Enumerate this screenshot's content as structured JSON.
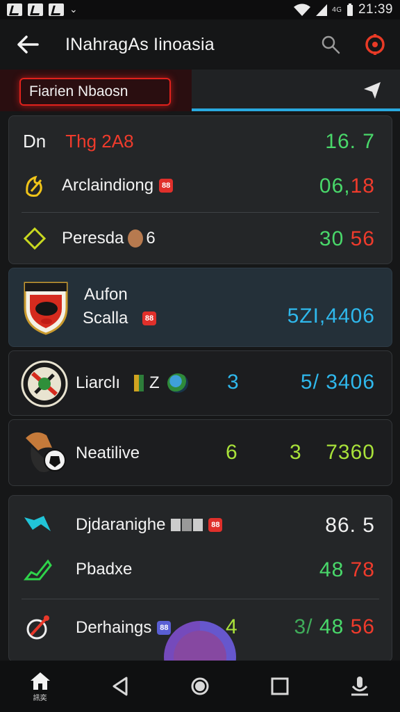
{
  "status_bar": {
    "time": "21:39",
    "signal_label": "4G"
  },
  "app_bar": {
    "title": "INahragAs Iinoasia"
  },
  "tabs": {
    "active_label": "Fiarien Nbaosn"
  },
  "card1": {
    "header": {
      "left": "Dn",
      "right_title": "Thg 2A8",
      "value": "16. 7"
    },
    "rows": [
      {
        "label": "Arclaindiong",
        "badge": "88",
        "value_a": "06",
        "value_sep": ",",
        "value_b": "18"
      },
      {
        "label": "Peresda",
        "suffix": "6",
        "value_a": "30",
        "value_b": "56"
      }
    ]
  },
  "card2": {
    "line1": "Aufon",
    "line2": "Scalla",
    "badge": "88",
    "value": "5ZI,4406"
  },
  "card3": {
    "label": "Liarclı",
    "mark_a": "Z",
    "col_mid": "3",
    "value": "5/ 3406"
  },
  "card4": {
    "label": "Neatilive",
    "col_mid": "6",
    "col_right": "3",
    "value": "7360"
  },
  "card5": {
    "rows": [
      {
        "label": "Djdaranighe",
        "badge": "88",
        "value": "86. 5"
      },
      {
        "label": "Pbadxe",
        "value_a": "48",
        "value_b": "78"
      },
      {
        "label": "Derhaings",
        "badge": "88",
        "col_mid": "4",
        "value_prefix": "3/",
        "value_a": "48",
        "value_b": "56"
      }
    ]
  },
  "nav": {
    "home_label": "訊奕"
  },
  "colors": {
    "accent_red": "#e0211c",
    "accent_cyan": "#29a9df",
    "positive": "#49d86a",
    "negative": "#ef3b2c"
  }
}
